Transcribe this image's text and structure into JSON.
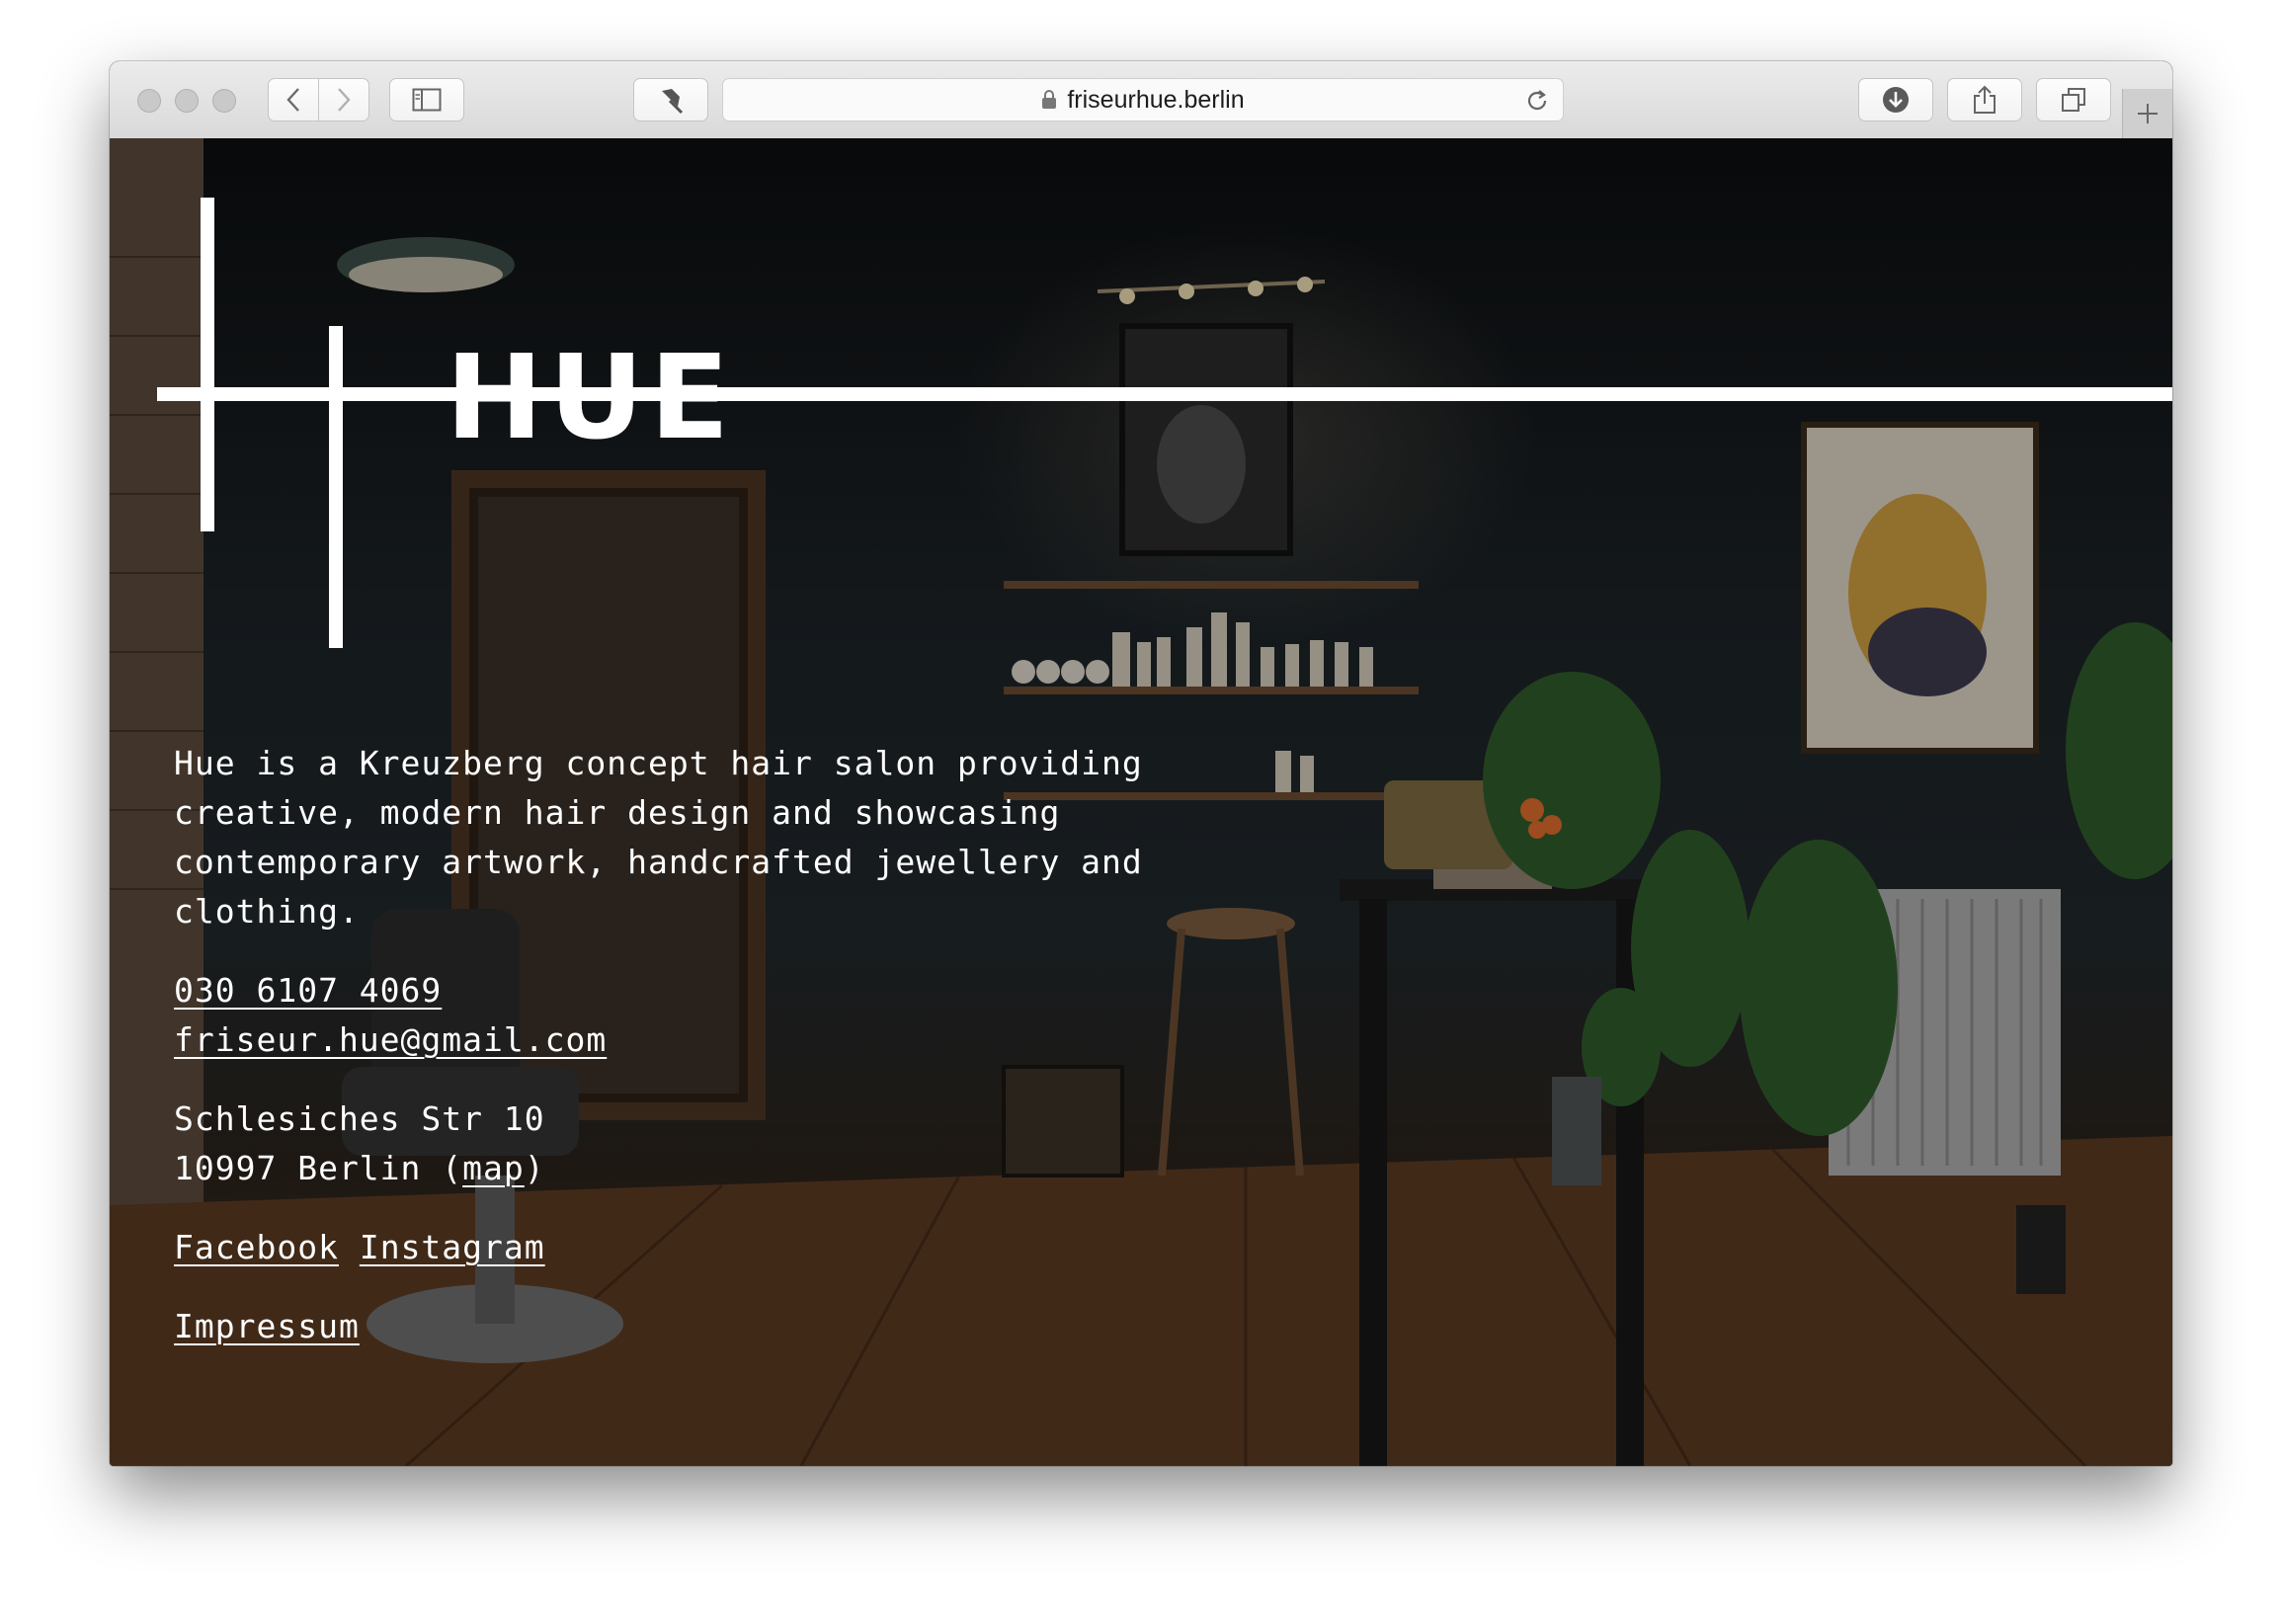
{
  "browser": {
    "url": "friseurhue.berlin",
    "icons": [
      "back-icon",
      "forward-icon",
      "sidebar-icon",
      "pin-icon",
      "lock-icon",
      "reload-icon",
      "download-icon",
      "share-icon",
      "tabs-icon",
      "plus-icon"
    ]
  },
  "site": {
    "logo_text": "HUE",
    "intro": "Hue is a Kreuzberg concept hair salon providing creative, modern hair design and showcasing contemporary artwork, handcrafted jewellery and clothing.",
    "phone": "030 6107 4069",
    "email": "friseur.hue@gmail.com",
    "address_line1": "Schlesiches Str 10",
    "address_line2_prefix": "10997 Berlin (",
    "map_label": "map",
    "address_line2_suffix": ")",
    "facebook": "Facebook",
    "instagram": "Instagram",
    "impressum": "Impressum"
  }
}
